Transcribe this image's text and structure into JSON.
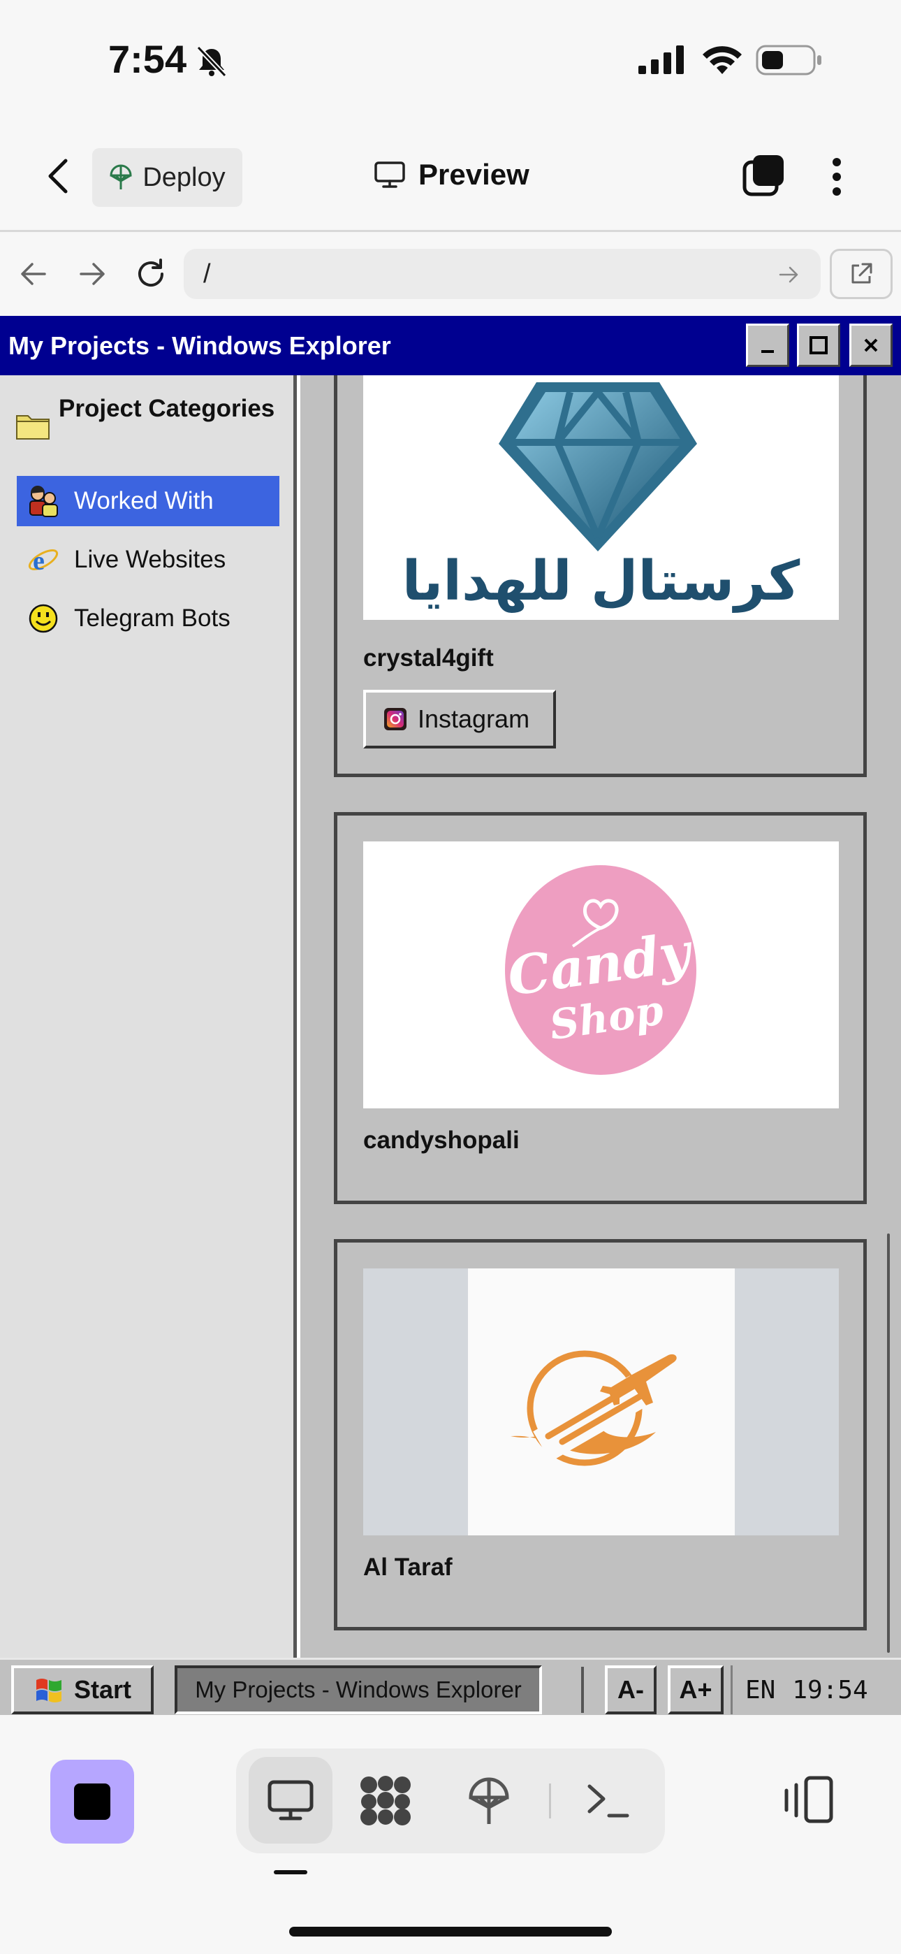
{
  "status_bar": {
    "time": "7:54"
  },
  "app_bar": {
    "deploy_label": "Deploy",
    "preview_label": "Preview"
  },
  "url_bar": {
    "url": "/"
  },
  "window": {
    "title": "My Projects - Windows Explorer"
  },
  "sidebar": {
    "heading": "Project Categories",
    "items": [
      {
        "label": "Worked With",
        "selected": true
      },
      {
        "label": "Live Websites",
        "selected": false
      },
      {
        "label": "Telegram Bots",
        "selected": false
      }
    ]
  },
  "projects": [
    {
      "name": "crystal4gift",
      "logo_text": "كرستال للهدايا",
      "button": "Instagram"
    },
    {
      "name": "candyshopali",
      "logo_text_1": "Candy",
      "logo_text_2": "Shop"
    },
    {
      "name": "Al Taraf"
    }
  ],
  "taskbar": {
    "start_label": "Start",
    "window_label": "My Projects - Windows Explorer",
    "font_smaller": "A-",
    "font_larger": "A+",
    "language": "EN",
    "clock": "19:54"
  },
  "colors": {
    "titlebar": "#000090",
    "selected": "#3c64e0",
    "diamond": "#3a7fa0",
    "candy_pink": "#ee9ec1",
    "taraf_orange": "#e8923a",
    "accent_purple": "#b6a6ff"
  }
}
